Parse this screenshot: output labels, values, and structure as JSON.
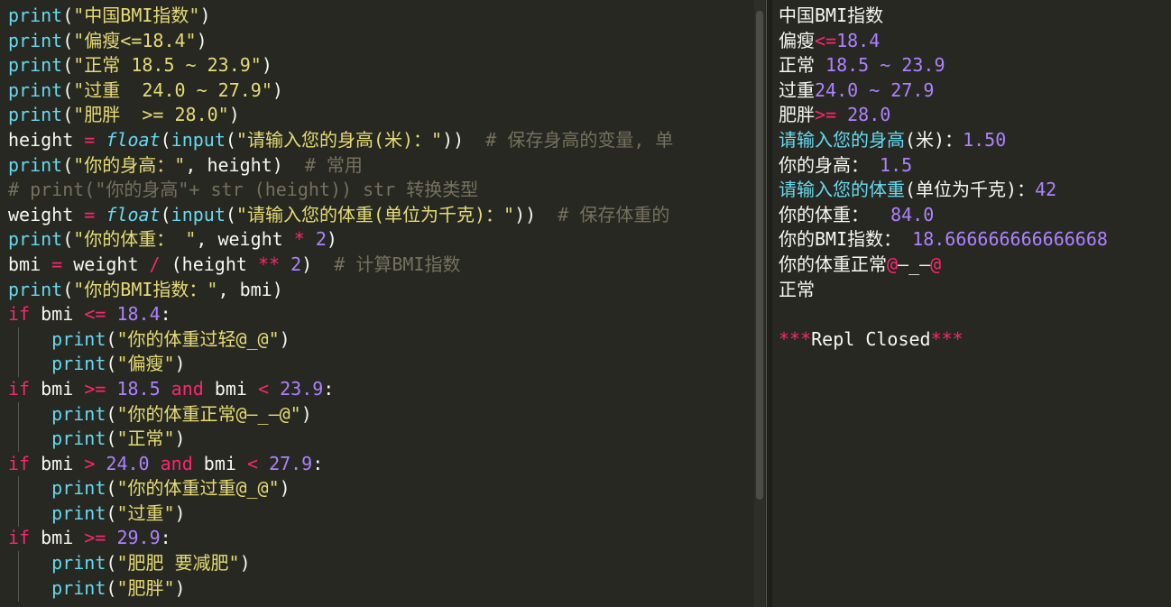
{
  "code": [
    [
      [
        "print",
        "blue"
      ],
      [
        "(",
        "white"
      ],
      [
        "\"中国BMI指数\"",
        "yellow"
      ],
      [
        ")",
        "white"
      ]
    ],
    [
      [
        "print",
        "blue"
      ],
      [
        "(",
        "white"
      ],
      [
        "\"偏瘦<=18.4\"",
        "yellow"
      ],
      [
        ")",
        "white"
      ]
    ],
    [
      [
        "print",
        "blue"
      ],
      [
        "(",
        "white"
      ],
      [
        "\"正常 18.5 ~ 23.9\"",
        "yellow"
      ],
      [
        ")",
        "white"
      ]
    ],
    [
      [
        "print",
        "blue"
      ],
      [
        "(",
        "white"
      ],
      [
        "\"过重  24.0 ~ 27.9\"",
        "yellow"
      ],
      [
        ")",
        "white"
      ]
    ],
    [
      [
        "print",
        "blue"
      ],
      [
        "(",
        "white"
      ],
      [
        "\"肥胖  >= 28.0\"",
        "yellow"
      ],
      [
        ")",
        "white"
      ]
    ],
    [
      [
        "height ",
        "white"
      ],
      [
        "=",
        "pink"
      ],
      [
        " ",
        "white"
      ],
      [
        "float",
        "ital"
      ],
      [
        "(",
        "white"
      ],
      [
        "input",
        "blue"
      ],
      [
        "(",
        "white"
      ],
      [
        "\"请输入您的身高(米)：\"",
        "yellow"
      ],
      [
        "))  ",
        "white"
      ],
      [
        "# 保存身高的变量, 单",
        "gray"
      ]
    ],
    [
      [
        "print",
        "blue"
      ],
      [
        "(",
        "white"
      ],
      [
        "\"你的身高：\"",
        "yellow"
      ],
      [
        ", height)  ",
        "white"
      ],
      [
        "# 常用",
        "gray"
      ]
    ],
    [
      [
        "# print(\"你的身高\"+ str (height)) str 转换类型",
        "gray"
      ]
    ],
    [
      [
        "weight ",
        "white"
      ],
      [
        "=",
        "pink"
      ],
      [
        " ",
        "white"
      ],
      [
        "float",
        "ital"
      ],
      [
        "(",
        "white"
      ],
      [
        "input",
        "blue"
      ],
      [
        "(",
        "white"
      ],
      [
        "\"请输入您的体重(单位为千克)：\"",
        "yellow"
      ],
      [
        "))  ",
        "white"
      ],
      [
        "# 保存体重的",
        "gray"
      ]
    ],
    [
      [
        "print",
        "blue"
      ],
      [
        "(",
        "white"
      ],
      [
        "\"你的体重： \"",
        "yellow"
      ],
      [
        ", weight ",
        "white"
      ],
      [
        "*",
        "pink"
      ],
      [
        " ",
        "white"
      ],
      [
        "2",
        "purple"
      ],
      [
        ")",
        "white"
      ]
    ],
    [
      [
        "bmi ",
        "white"
      ],
      [
        "=",
        "pink"
      ],
      [
        " weight ",
        "white"
      ],
      [
        "/",
        "pink"
      ],
      [
        " (height ",
        "white"
      ],
      [
        "**",
        "pink"
      ],
      [
        " ",
        "white"
      ],
      [
        "2",
        "purple"
      ],
      [
        ")  ",
        "white"
      ],
      [
        "# 计算BMI指数",
        "gray"
      ]
    ],
    [
      [
        "print",
        "blue"
      ],
      [
        "(",
        "white"
      ],
      [
        "\"你的BMI指数：\"",
        "yellow"
      ],
      [
        ", bmi)",
        "white"
      ]
    ],
    [
      [
        "if",
        "pink"
      ],
      [
        " bmi ",
        "white"
      ],
      [
        "<=",
        "pink"
      ],
      [
        " ",
        "white"
      ],
      [
        "18.4",
        "purple"
      ],
      [
        ":",
        "white"
      ]
    ],
    [
      [
        "    ",
        "white"
      ],
      [
        "print",
        "blue"
      ],
      [
        "(",
        "white"
      ],
      [
        "\"你的体重过轻@_@\"",
        "yellow"
      ],
      [
        ")",
        "white"
      ]
    ],
    [
      [
        "    ",
        "white"
      ],
      [
        "print",
        "blue"
      ],
      [
        "(",
        "white"
      ],
      [
        "\"偏瘦\"",
        "yellow"
      ],
      [
        ")",
        "white"
      ]
    ],
    [
      [
        "if",
        "pink"
      ],
      [
        " bmi ",
        "white"
      ],
      [
        ">=",
        "pink"
      ],
      [
        " ",
        "white"
      ],
      [
        "18.5",
        "purple"
      ],
      [
        " ",
        "white"
      ],
      [
        "and",
        "pink"
      ],
      [
        " bmi ",
        "white"
      ],
      [
        "<",
        "pink"
      ],
      [
        " ",
        "white"
      ],
      [
        "23.9",
        "purple"
      ],
      [
        ":",
        "white"
      ]
    ],
    [
      [
        "    ",
        "white"
      ],
      [
        "print",
        "blue"
      ],
      [
        "(",
        "white"
      ],
      [
        "\"你的体重正常@–_–@\"",
        "yellow"
      ],
      [
        ")",
        "white"
      ]
    ],
    [
      [
        "    ",
        "white"
      ],
      [
        "print",
        "blue"
      ],
      [
        "(",
        "white"
      ],
      [
        "\"正常\"",
        "yellow"
      ],
      [
        ")",
        "white"
      ]
    ],
    [
      [
        "if",
        "pink"
      ],
      [
        " bmi ",
        "white"
      ],
      [
        ">",
        "pink"
      ],
      [
        " ",
        "white"
      ],
      [
        "24.0",
        "purple"
      ],
      [
        " ",
        "white"
      ],
      [
        "and",
        "pink"
      ],
      [
        " bmi ",
        "white"
      ],
      [
        "<",
        "pink"
      ],
      [
        " ",
        "white"
      ],
      [
        "27.9",
        "purple"
      ],
      [
        ":",
        "white"
      ]
    ],
    [
      [
        "    ",
        "white"
      ],
      [
        "print",
        "blue"
      ],
      [
        "(",
        "white"
      ],
      [
        "\"你的体重过重@_@\"",
        "yellow"
      ],
      [
        ")",
        "white"
      ]
    ],
    [
      [
        "    ",
        "white"
      ],
      [
        "print",
        "blue"
      ],
      [
        "(",
        "white"
      ],
      [
        "\"过重\"",
        "yellow"
      ],
      [
        ")",
        "white"
      ]
    ],
    [
      [
        "if",
        "pink"
      ],
      [
        " bmi ",
        "white"
      ],
      [
        ">=",
        "pink"
      ],
      [
        " ",
        "white"
      ],
      [
        "29.9",
        "purple"
      ],
      [
        ":",
        "white"
      ]
    ],
    [
      [
        "    ",
        "white"
      ],
      [
        "print",
        "blue"
      ],
      [
        "(",
        "white"
      ],
      [
        "\"肥肥 要减肥\"",
        "yellow"
      ],
      [
        ")",
        "white"
      ]
    ],
    [
      [
        "    ",
        "white"
      ],
      [
        "print",
        "blue"
      ],
      [
        "(",
        "white"
      ],
      [
        "\"肥胖\"",
        "yellow"
      ],
      [
        ")",
        "white"
      ]
    ]
  ],
  "output": [
    [
      [
        "中国BMI指数",
        "white"
      ]
    ],
    [
      [
        "偏瘦",
        "white"
      ],
      [
        "<=",
        "pink"
      ],
      [
        "18.4",
        "purple"
      ]
    ],
    [
      [
        "正常 ",
        "white"
      ],
      [
        "18.5 ~ 23.9",
        "purple"
      ]
    ],
    [
      [
        "过重",
        "white"
      ],
      [
        "24.0 ~ 27.9",
        "purple"
      ]
    ],
    [
      [
        "肥胖",
        "white"
      ],
      [
        ">=",
        "pink"
      ],
      [
        " 28.0",
        "purple"
      ]
    ],
    [
      [
        "请输入您的身高",
        "blue"
      ],
      [
        "(米)",
        "white"
      ],
      [
        "：",
        "white"
      ],
      [
        "1.50",
        "purple"
      ]
    ],
    [
      [
        "你的身高： ",
        "white"
      ],
      [
        "1.5",
        "purple"
      ]
    ],
    [
      [
        "请输入您的体重",
        "blue"
      ],
      [
        "(单位为千克)：",
        "white"
      ],
      [
        "42",
        "purple"
      ]
    ],
    [
      [
        "你的体重：  ",
        "white"
      ],
      [
        "84.0",
        "purple"
      ]
    ],
    [
      [
        "你的BMI指数： ",
        "white"
      ],
      [
        "18.666666666666668",
        "purple"
      ]
    ],
    [
      [
        "你的体重正常",
        "white"
      ],
      [
        "@",
        "pink"
      ],
      [
        "–_–",
        "white"
      ],
      [
        "@",
        "pink"
      ]
    ],
    [
      [
        "正常",
        "white"
      ]
    ],
    [
      [
        "",
        "white"
      ]
    ],
    [
      [
        "***",
        "pink"
      ],
      [
        "Repl Closed",
        "white"
      ],
      [
        "***",
        "pink"
      ]
    ]
  ],
  "colors": {
    "background": "#272822",
    "blue": "#66d9ef",
    "yellow": "#e6db74",
    "pink": "#f92672",
    "purple": "#ae81ff",
    "gray": "#75715e",
    "white": "#f8f8f2"
  }
}
